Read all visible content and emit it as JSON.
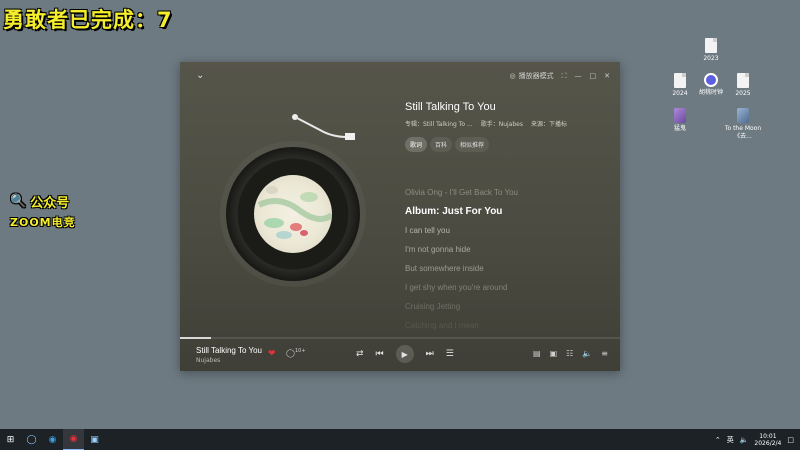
{
  "overlay": {
    "title": "勇敢者已完成：7",
    "watermark_line1": "公众号",
    "watermark_line2": "ZOOM电竞"
  },
  "desktop_icons": [
    {
      "label": "2023"
    },
    {
      "label": "2024"
    },
    {
      "label": "胡桃时钟"
    },
    {
      "label": "2025"
    },
    {
      "label": "猛鬼"
    },
    {
      "label": "To the Moon《去..."
    }
  ],
  "player": {
    "mode_label": "播放器模式",
    "song_title": "Still Talking To You",
    "album": "专辑：Still Talking To ...",
    "artist": "歌手：Nujabes",
    "source": "来源：下播标",
    "tabs": [
      "歌词",
      "百科",
      "相似推荐"
    ],
    "lyrics": [
      "Olivia Ong - I'll Get Back To You",
      "Album: Just For You",
      "I can tell you",
      "I'm not gonna hide",
      "But somewhere inside",
      "I get shy when you're around",
      "Cruising Jetting",
      "Catching and I mean"
    ],
    "current_lyric_index": 1,
    "progress": 0.07,
    "now_playing_title": "Still Talking To You",
    "now_playing_artist": "Nujabes",
    "comment_count": "10+"
  },
  "taskbar": {
    "ime": "英",
    "time": "10:01",
    "date": "2026/2/4"
  },
  "colors": {
    "accent_overlay": "#f5ee2c",
    "like": "#e2323e",
    "player_bg": "#4e4e44"
  }
}
